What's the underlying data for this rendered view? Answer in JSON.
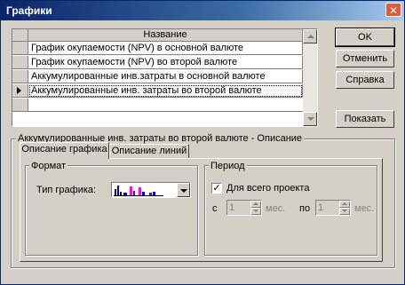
{
  "window": {
    "title": "Графики"
  },
  "grid": {
    "header": "Название",
    "rows": [
      "График окупаемости (NPV) в основной валюте",
      "График окупаемости (NPV) во второй валюте",
      "Аккумулированные инв.затраты в основной валюте",
      "Аккумулированные инв. затраты во второй валюте"
    ],
    "selected_row": 3
  },
  "buttons": {
    "ok": "OK",
    "cancel": "Отменить",
    "help": "Справка",
    "show": "Показать"
  },
  "description_group": {
    "label": "Аккумулированные инв. затраты во второй валюте - Описание",
    "tabs": [
      "Описание графика",
      "Описание линий"
    ],
    "active_tab": 0
  },
  "format": {
    "label": "Формат",
    "chart_type_label": "Тип графика:",
    "chart_type_icon": "bar-chart-icon",
    "chart_type_colors": [
      "#000080",
      "#ff00ff",
      "#0000ff",
      "#800080"
    ]
  },
  "period": {
    "label": "Период",
    "whole_project_label": "Для всего проекта",
    "whole_project_checked": true,
    "from_label": "с",
    "from_value": "1",
    "from_unit": "мес.",
    "to_label": "по",
    "to_value": "1",
    "to_unit": "мес."
  }
}
